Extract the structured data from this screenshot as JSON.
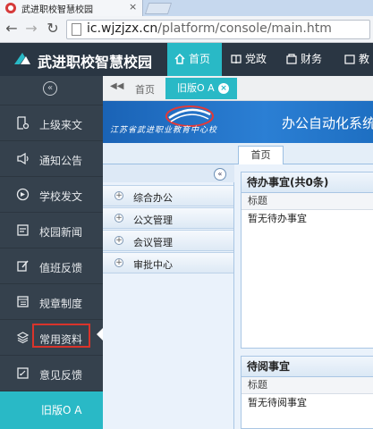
{
  "browser": {
    "tab_title": "武进职校智慧校园",
    "tab_close": "×",
    "url_host": "ic.wjzjzx.cn",
    "url_path": "/platform/console/main.htm"
  },
  "app": {
    "brand": "武进职校智慧校园",
    "topnav": [
      {
        "label": "首页",
        "active": true
      },
      {
        "label": "党政"
      },
      {
        "label": "财务"
      },
      {
        "label": "教"
      }
    ]
  },
  "sidebar": {
    "collapse_glyph": "«",
    "items": [
      {
        "label": "上级来文",
        "icon": "document-stamp-icon"
      },
      {
        "label": "通知公告",
        "icon": "megaphone-icon"
      },
      {
        "label": "学校发文",
        "icon": "send-icon"
      },
      {
        "label": "校园新闻",
        "icon": "news-icon"
      },
      {
        "label": "值班反馈",
        "icon": "edit-icon"
      },
      {
        "label": "规章制度",
        "icon": "rules-icon"
      },
      {
        "label": "常用资料",
        "icon": "layers-icon"
      },
      {
        "label": "意见反馈",
        "icon": "feedback-icon"
      },
      {
        "label": "旧版O A",
        "active": true
      }
    ]
  },
  "tabs": {
    "home": "首页",
    "oa": "旧版O A",
    "close": "×"
  },
  "oa": {
    "school_name": "江苏省武进职业教育中心校",
    "system_title": "办公自动化系统",
    "home_tab": "首页",
    "menu_collapse": "«",
    "menu_items": [
      "综合办公",
      "公文管理",
      "会议管理",
      "审批中心"
    ],
    "panels": [
      {
        "title": "待办事宜(共0条)",
        "column": "标题",
        "row": "暂无待办事宜"
      },
      {
        "title": "待阅事宜",
        "column": "标题",
        "row": "暂无待阅事宜"
      }
    ]
  },
  "colors": {
    "accent": "#29b9c6",
    "sidebar_bg": "#35414d",
    "header_bg": "#2a3643",
    "highlight_frame": "#d9342b"
  }
}
